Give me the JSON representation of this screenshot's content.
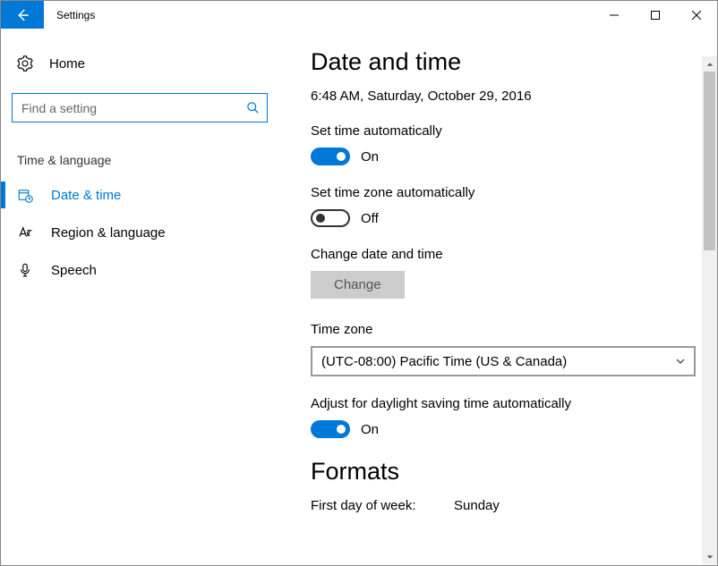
{
  "window": {
    "title": "Settings"
  },
  "sidebar": {
    "home": "Home",
    "search_placeholder": "Find a setting",
    "group": "Time & language",
    "items": [
      {
        "label": "Date & time",
        "active": true
      },
      {
        "label": "Region & language",
        "active": false
      },
      {
        "label": "Speech",
        "active": false
      }
    ]
  },
  "page": {
    "title": "Date and time",
    "current_datetime": "6:48 AM, Saturday, October 29, 2016",
    "set_time_auto": {
      "label": "Set time automatically",
      "state_text": "On",
      "on": true
    },
    "set_tz_auto": {
      "label": "Set time zone automatically",
      "state_text": "Off",
      "on": false
    },
    "change_section": {
      "label": "Change date and time",
      "button": "Change"
    },
    "timezone": {
      "label": "Time zone",
      "value": "(UTC-08:00) Pacific Time (US & Canada)"
    },
    "dst": {
      "label": "Adjust for daylight saving time automatically",
      "state_text": "On",
      "on": true
    },
    "formats": {
      "title": "Formats",
      "first_day_label": "First day of week:",
      "first_day_value": "Sunday"
    }
  }
}
